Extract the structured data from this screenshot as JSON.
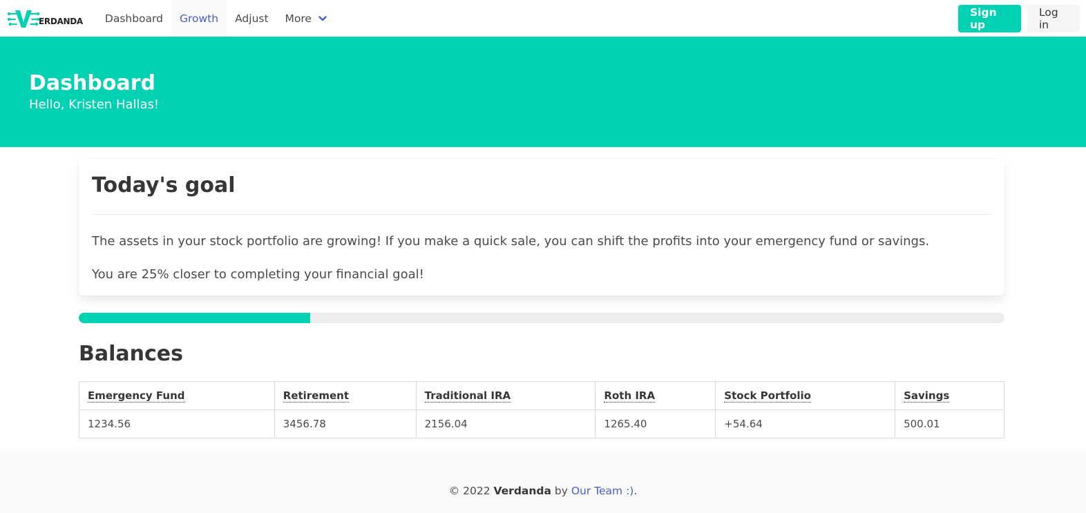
{
  "brand": {
    "logo_text": "ERDANDA",
    "accent": "#00d1b2"
  },
  "nav": {
    "items": [
      {
        "label": "Dashboard"
      },
      {
        "label": "Growth"
      },
      {
        "label": "Adjust"
      },
      {
        "label": "More"
      }
    ],
    "active_index": 1,
    "more_icon": "chevron-down-icon",
    "signup_label": "Sign up",
    "login_label": "Log in"
  },
  "hero": {
    "title": "Dashboard",
    "subtitle": "Hello, Kristen Hallas!"
  },
  "goal": {
    "title": "Today's goal",
    "message": "The assets in your stock portfolio are growing! If you make a quick sale, you can shift the profits into your emergency fund or savings.",
    "progress_text": "You are 25% closer to completing your financial goal!",
    "progress_fraction": 0.25
  },
  "balances": {
    "title": "Balances",
    "columns": [
      "Emergency Fund",
      "Retirement",
      "Traditional IRA",
      "Roth IRA",
      "Stock Portfolio",
      "Savings"
    ],
    "values": [
      "1234.56",
      "3456.78",
      "2156.04",
      "1265.40",
      "+54.64",
      "500.01"
    ]
  },
  "footer": {
    "copyright": "© 2022",
    "brand": "Verdanda",
    "by": "by",
    "team_link": "Our Team :)",
    "period": "."
  }
}
